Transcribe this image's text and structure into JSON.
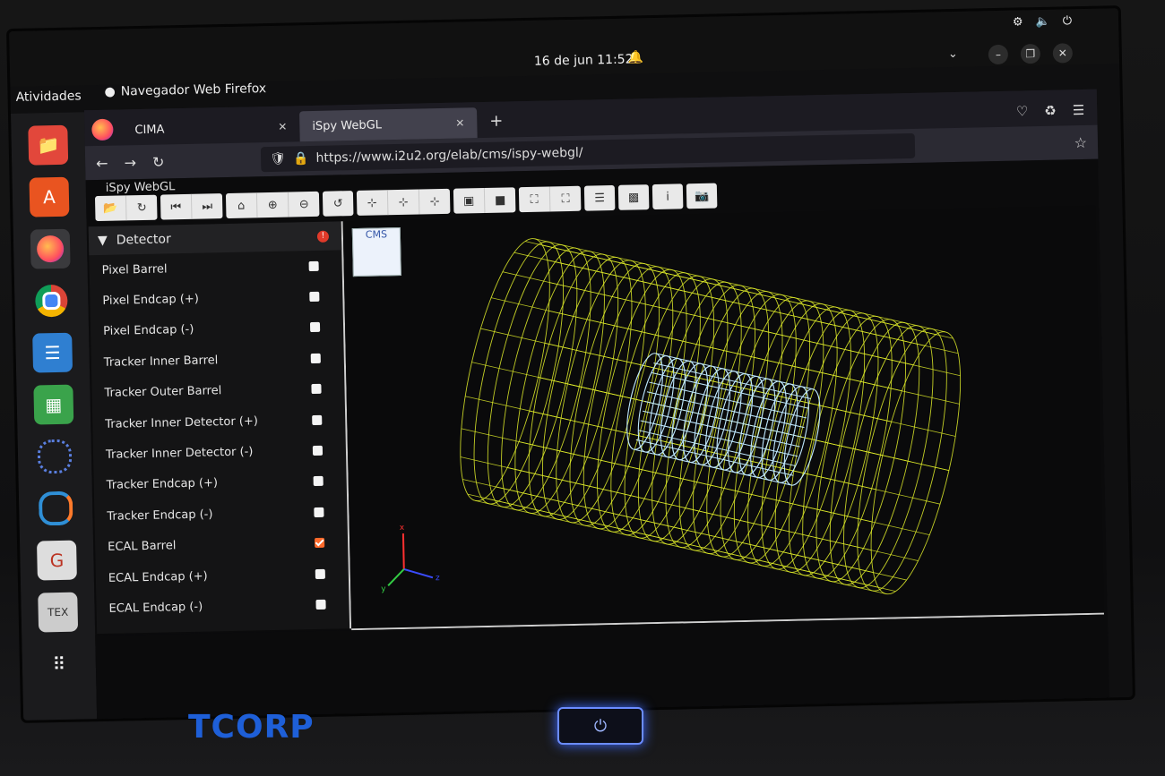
{
  "topbar": {
    "activities": "Atividades",
    "app_title": "Navegador Web Firefox",
    "clock": "16 de jun  11:52"
  },
  "tabs": [
    {
      "label": "CIMA",
      "active": false
    },
    {
      "label": "iSpy WebGL",
      "active": true
    }
  ],
  "url": "https://www.i2u2.org/elab/cms/ispy-webgl/",
  "page": {
    "app_name": "iSpy WebGL",
    "panel_title": "Detector",
    "items": [
      {
        "label": "Pixel Barrel",
        "checked": false
      },
      {
        "label": "Pixel Endcap (+)",
        "checked": false
      },
      {
        "label": "Pixel Endcap (-)",
        "checked": false
      },
      {
        "label": "Tracker Inner Barrel",
        "checked": false
      },
      {
        "label": "Tracker Outer Barrel",
        "checked": false
      },
      {
        "label": "Tracker Inner Detector (+)",
        "checked": false
      },
      {
        "label": "Tracker Inner Detector (-)",
        "checked": false
      },
      {
        "label": "Tracker Endcap (+)",
        "checked": false
      },
      {
        "label": "Tracker Endcap (-)",
        "checked": false
      },
      {
        "label": "ECAL Barrel",
        "checked": true
      },
      {
        "label": "ECAL Endcap (+)",
        "checked": false
      },
      {
        "label": "ECAL Endcap (-)",
        "checked": false
      }
    ],
    "logo_text": "CMS",
    "axes": {
      "x": "x",
      "y": "y",
      "z": "z"
    }
  },
  "brand": "TCORP",
  "colors": {
    "wire": "#e3f02a",
    "tracker": "#bfe9ff",
    "accent": "#ff6a2b"
  }
}
